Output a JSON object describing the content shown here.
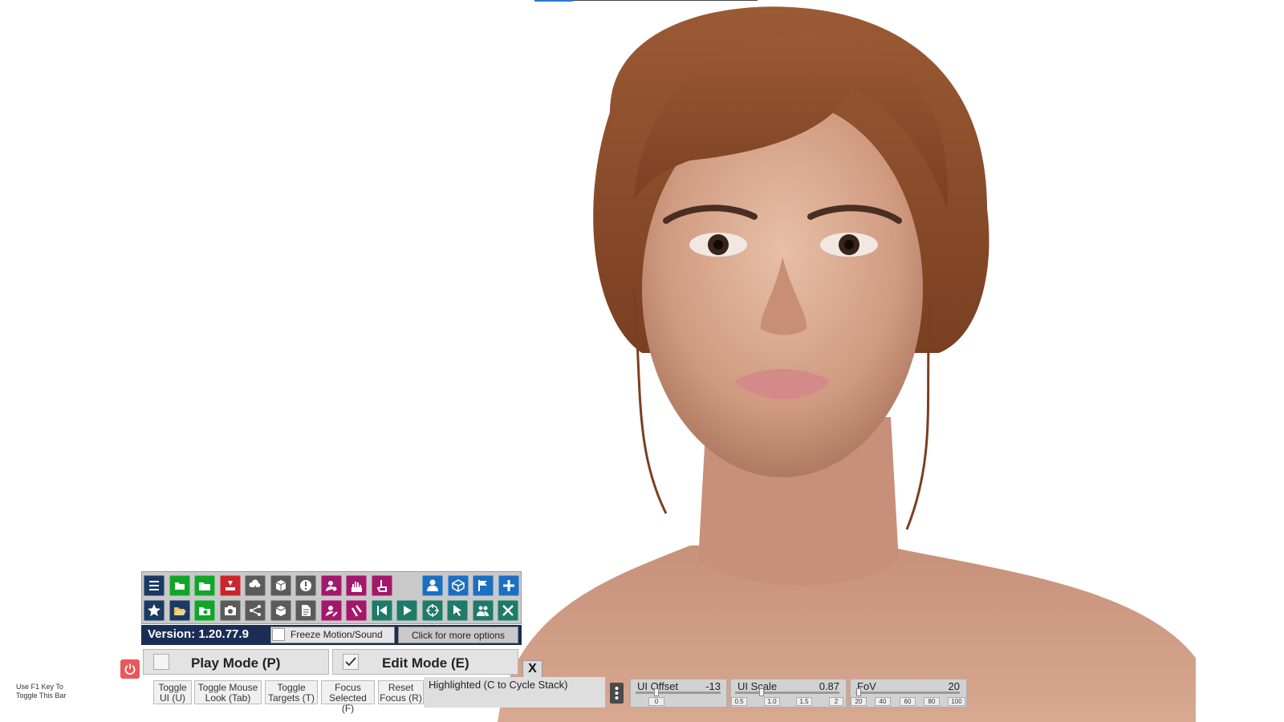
{
  "toolbar": {
    "row1": [
      {
        "icon": "menu-icon",
        "color": "#1b3a63"
      },
      {
        "icon": "open-scene-icon",
        "color": "#12a52a"
      },
      {
        "icon": "folder-icon",
        "color": "#12a52a"
      },
      {
        "icon": "save-icon",
        "color": "#c9262b"
      },
      {
        "icon": "cloud-download-icon",
        "color": "#5b5b5b"
      },
      {
        "icon": "package-icon",
        "color": "#5b5b5b"
      },
      {
        "icon": "alert-icon",
        "color": "#5b5b5b"
      },
      {
        "icon": "person-settings-icon",
        "color": "#a3186b"
      },
      {
        "icon": "hand-icon",
        "color": "#a3186b"
      },
      {
        "icon": "pointer-hand-icon",
        "color": "#a3186b"
      },
      {
        "icon": "person-icon",
        "color": "#1c6fc1"
      },
      {
        "icon": "unity-icon",
        "color": "#1c6fc1"
      },
      {
        "icon": "flag-icon",
        "color": "#1c6fc1"
      },
      {
        "icon": "plus-icon",
        "color": "#1c6fc1"
      }
    ],
    "row2": [
      {
        "icon": "star-icon",
        "color": "#1b3a63"
      },
      {
        "icon": "open-folder-icon",
        "color": "#1b3a63"
      },
      {
        "icon": "folder-gear-icon",
        "color": "#12a52a"
      },
      {
        "icon": "camera-icon",
        "color": "#5b5b5b"
      },
      {
        "icon": "share-icon",
        "color": "#5b5b5b"
      },
      {
        "icon": "box-arrows-icon",
        "color": "#5b5b5b"
      },
      {
        "icon": "document-icon",
        "color": "#5b5b5b"
      },
      {
        "icon": "person-edit-icon",
        "color": "#a3186b"
      },
      {
        "icon": "grab-hand-icon",
        "color": "#a3186b"
      },
      {
        "icon": "skip-back-icon",
        "color": "#1f7a69"
      },
      {
        "icon": "play-icon",
        "color": "#1f7a69"
      },
      {
        "icon": "target-icon",
        "color": "#1f7a69"
      },
      {
        "icon": "cursor-icon",
        "color": "#1f7a69"
      },
      {
        "icon": "people-icon",
        "color": "#1f7a69"
      },
      {
        "icon": "tools-icon",
        "color": "#1f7a69"
      }
    ]
  },
  "version": "Version: 1.20.77.9",
  "freeze_label": "Freeze Motion/Sound",
  "more_options_label": "Click for more options",
  "play_mode_label": "Play Mode (P)",
  "edit_mode_label": "Edit Mode (E)",
  "edit_mode_checked": true,
  "close_label": "X",
  "hint": {
    "line1": "Use F1 Key To",
    "line2": "Toggle This Bar"
  },
  "buttons": [
    {
      "l1": "Toggle",
      "l2": "UI (U)"
    },
    {
      "l1": "Toggle Mouse",
      "l2": "Look (Tab)"
    },
    {
      "l1": "Toggle",
      "l2": "Targets (T)"
    },
    {
      "l1": "Focus",
      "l2": "Selected (F)"
    },
    {
      "l1": "Reset",
      "l2": "Focus (R)"
    }
  ],
  "highlighted_text": "Highlighted (C to Cycle Stack)",
  "sliders": {
    "ui_offset": {
      "label": "UI Offset",
      "value": "-13",
      "fraction": 0.2,
      "ticks": [
        "0"
      ]
    },
    "ui_scale": {
      "label": "UI Scale",
      "value": "0.87",
      "fraction": 0.25,
      "ticks": [
        "0.5",
        "1.0",
        "1.5",
        "2"
      ]
    },
    "fov": {
      "label": "FoV",
      "value": "20",
      "fraction": 0.0,
      "ticks": [
        "20",
        "40",
        "60",
        "80",
        "100"
      ]
    }
  }
}
